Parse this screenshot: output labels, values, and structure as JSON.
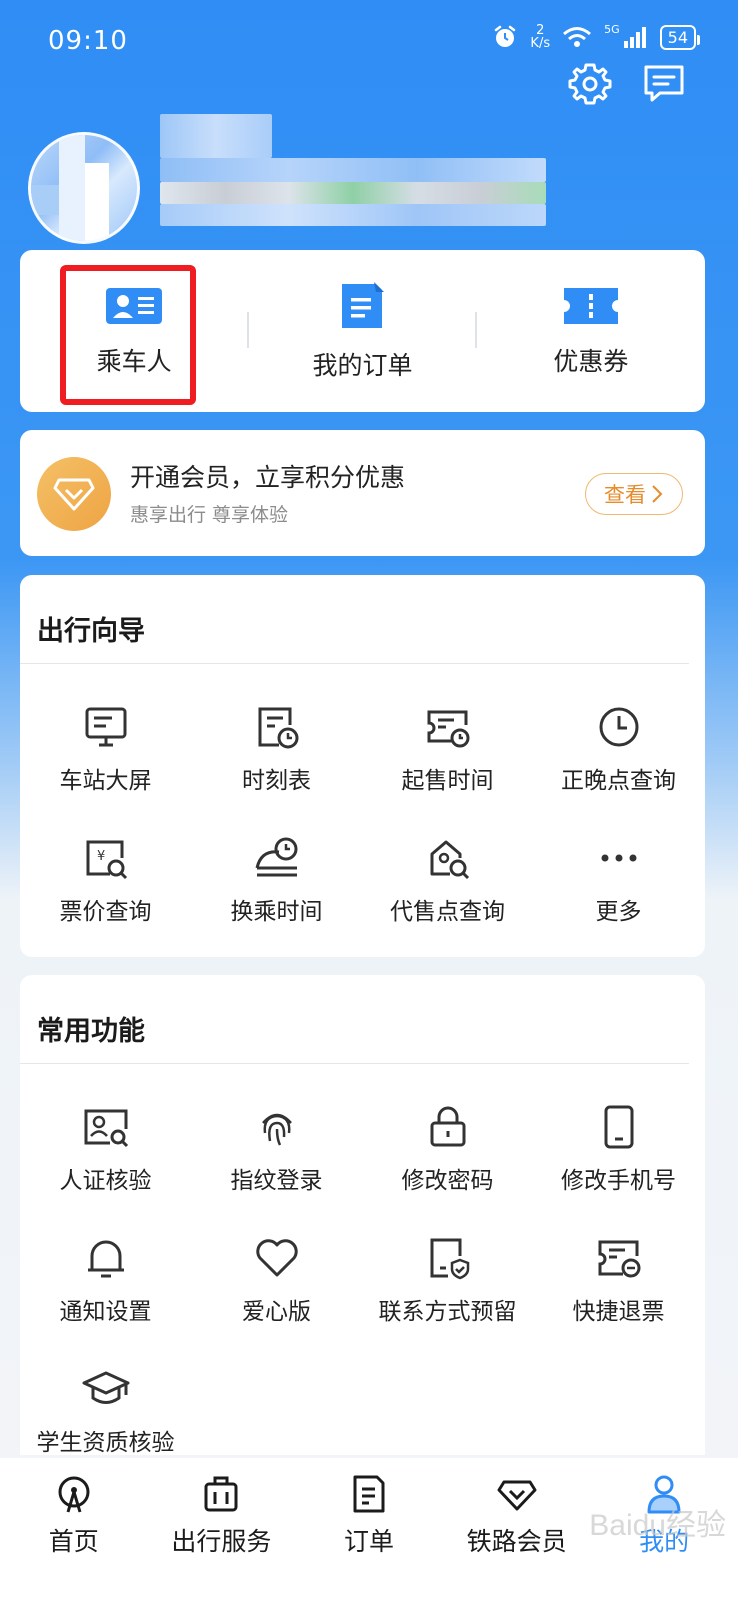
{
  "status_bar": {
    "time": "09:10",
    "speed_value": "2",
    "speed_unit": "K/s",
    "network": "5G",
    "battery": "54"
  },
  "header": {
    "settings_icon": "gear-icon",
    "message_icon": "message-icon"
  },
  "shortcuts": [
    {
      "label": "乘车人",
      "icon": "passenger-card-icon"
    },
    {
      "label": "我的订单",
      "icon": "order-list-icon"
    },
    {
      "label": "优惠券",
      "icon": "coupon-icon"
    }
  ],
  "membership": {
    "title": "开通会员，立享积分优惠",
    "subtitle": "惠享出行 尊享体验",
    "button": "查看"
  },
  "travel_guide": {
    "title": "出行向导",
    "items": [
      {
        "label": "车站大屏",
        "icon": "station-screen-icon"
      },
      {
        "label": "时刻表",
        "icon": "timetable-icon"
      },
      {
        "label": "起售时间",
        "icon": "sale-time-icon"
      },
      {
        "label": "正晚点查询",
        "icon": "clock-icon"
      },
      {
        "label": "票价查询",
        "icon": "fare-search-icon"
      },
      {
        "label": "换乘时间",
        "icon": "transfer-time-icon"
      },
      {
        "label": "代售点查询",
        "icon": "agency-search-icon"
      },
      {
        "label": "更多",
        "icon": "more-icon"
      }
    ]
  },
  "common_functions": {
    "title": "常用功能",
    "items": [
      {
        "label": "人证核验",
        "icon": "id-verify-icon"
      },
      {
        "label": "指纹登录",
        "icon": "fingerprint-icon"
      },
      {
        "label": "修改密码",
        "icon": "lock-icon"
      },
      {
        "label": "修改手机号",
        "icon": "phone-icon"
      },
      {
        "label": "通知设置",
        "icon": "bell-icon"
      },
      {
        "label": "爱心版",
        "icon": "heart-icon"
      },
      {
        "label": "联系方式预留",
        "icon": "contact-reserve-icon"
      },
      {
        "label": "快捷退票",
        "icon": "quick-refund-icon"
      },
      {
        "label": "学生资质核验",
        "icon": "graduation-cap-icon"
      }
    ]
  },
  "bottom_nav": [
    {
      "label": "首页",
      "icon": "train-home-icon"
    },
    {
      "label": "出行服务",
      "icon": "luggage-icon"
    },
    {
      "label": "订单",
      "icon": "order-icon"
    },
    {
      "label": "铁路会员",
      "icon": "diamond-icon"
    },
    {
      "label": "我的",
      "icon": "user-icon",
      "active": true
    }
  ],
  "watermark": "Baidu经验",
  "colors": {
    "primary": "#2f8df5",
    "highlight": "#ef1c22",
    "member_gold": "#eea443"
  }
}
